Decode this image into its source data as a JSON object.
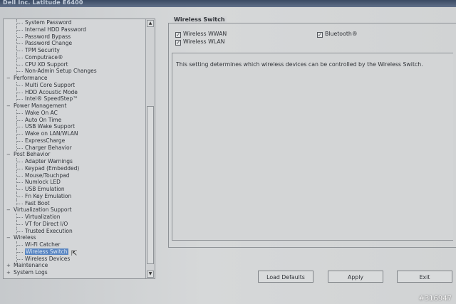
{
  "window": {
    "title": "Dell Inc. Latitude E6400"
  },
  "tree": {
    "rows": [
      {
        "type": "item",
        "label": "System Password"
      },
      {
        "type": "item",
        "label": "Internal HDD Password"
      },
      {
        "type": "item",
        "label": "Password Bypass"
      },
      {
        "type": "item",
        "label": "Password Change"
      },
      {
        "type": "item",
        "label": "TPM Security"
      },
      {
        "type": "item",
        "label": "Computrace®"
      },
      {
        "type": "item",
        "label": "CPU XD Support"
      },
      {
        "type": "item",
        "label": "Non-Admin Setup Changes"
      },
      {
        "type": "cat",
        "expander": "−",
        "label": "Performance"
      },
      {
        "type": "item",
        "label": "Multi Core Support"
      },
      {
        "type": "item",
        "label": "HDD Acoustic Mode"
      },
      {
        "type": "item",
        "label": "Intel® SpeedStep™"
      },
      {
        "type": "cat",
        "expander": "−",
        "label": "Power Management"
      },
      {
        "type": "item",
        "label": "Wake On AC"
      },
      {
        "type": "item",
        "label": "Auto On Time"
      },
      {
        "type": "item",
        "label": "USB Wake Support"
      },
      {
        "type": "item",
        "label": "Wake on LAN/WLAN"
      },
      {
        "type": "item",
        "label": "ExpressCharge"
      },
      {
        "type": "item",
        "label": "Charger Behavior"
      },
      {
        "type": "cat",
        "expander": "−",
        "label": "Post Behavior"
      },
      {
        "type": "item",
        "label": "Adapter Warnings"
      },
      {
        "type": "item",
        "label": "Keypad (Embedded)"
      },
      {
        "type": "item",
        "label": "Mouse/Touchpad"
      },
      {
        "type": "item",
        "label": "Numlock LED"
      },
      {
        "type": "item",
        "label": "USB Emulation"
      },
      {
        "type": "item",
        "label": "Fn Key Emulation"
      },
      {
        "type": "item",
        "label": "Fast Boot"
      },
      {
        "type": "cat",
        "expander": "−",
        "label": "Virtualization Support"
      },
      {
        "type": "item",
        "label": "Virtualization"
      },
      {
        "type": "item",
        "label": "VT for Direct I/O"
      },
      {
        "type": "item",
        "label": "Trusted Execution"
      },
      {
        "type": "cat",
        "expander": "−",
        "label": "Wireless"
      },
      {
        "type": "item",
        "label": "Wi-Fi Catcher"
      },
      {
        "type": "item",
        "label": "Wireless Switch",
        "selected": true
      },
      {
        "type": "item",
        "label": "Wireless Devices"
      },
      {
        "type": "cat",
        "expander": "+",
        "label": "Maintenance"
      },
      {
        "type": "cat",
        "expander": "+",
        "label": "System Logs"
      }
    ]
  },
  "scrollbar": {
    "up": "▲",
    "down": "▼"
  },
  "panel": {
    "title": "Wireless Switch",
    "options": {
      "wwan": {
        "label": "Wireless WWAN",
        "checked": true,
        "mark": "✓"
      },
      "wlan": {
        "label": "Wireless WLAN",
        "checked": true,
        "mark": "✓"
      },
      "bluetooth": {
        "label": "Bluetooth®",
        "checked": true,
        "mark": "✓"
      }
    },
    "description": "This setting determines which wireless devices can be controlled by the Wireless Switch."
  },
  "buttons": {
    "load_defaults": "Load Defaults",
    "apply": "Apply",
    "exit": "Exit"
  },
  "watermark": "#316947"
}
